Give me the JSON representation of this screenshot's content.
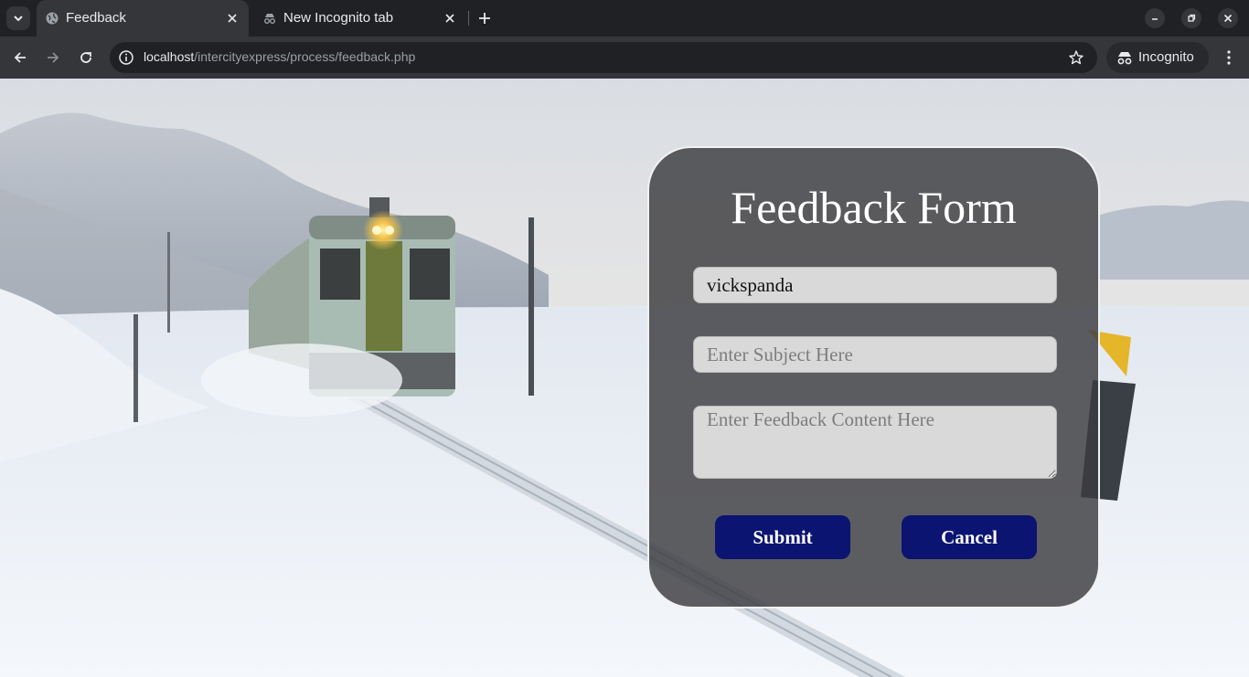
{
  "browser": {
    "tabs": [
      {
        "title": "Feedback",
        "active": true,
        "icon": "globe-icon"
      },
      {
        "title": "New Incognito tab",
        "active": false,
        "icon": "incognito-icon"
      }
    ],
    "url_host": "localhost",
    "url_path": "/intercityexpress/process/feedback.php",
    "profile_label": "Incognito"
  },
  "form": {
    "title": "Feedback Form",
    "name_value": "vickspanda",
    "subject_placeholder": "Enter Subject Here",
    "content_placeholder": "Enter Feedback Content Here",
    "submit_label": "Submit",
    "cancel_label": "Cancel"
  },
  "colors": {
    "button_bg": "#0b1470",
    "card_bg": "rgba(60,60,64,0.82)",
    "chrome_dark": "#202124",
    "chrome_toolbar": "#35363a"
  }
}
